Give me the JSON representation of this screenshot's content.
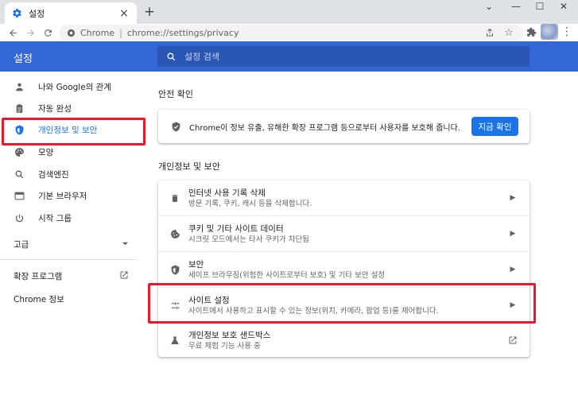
{
  "browser": {
    "tab_title": "설정",
    "tab_close": "×",
    "new_tab": "+",
    "omnibox_origin": "Chrome",
    "omnibox_separator": "|",
    "omnibox_url": "chrome://settings/privacy",
    "window_controls": {
      "chevron": "⌄",
      "minimize": "—",
      "maximize": "☐",
      "close": "✕"
    },
    "menu_glyph": "⋮"
  },
  "header": {
    "title": "설정",
    "search_placeholder": "설정 검색"
  },
  "sidebar": {
    "items": [
      {
        "label": "나와 Google의 관계",
        "icon": "person-icon",
        "active": false
      },
      {
        "label": "자동 완성",
        "icon": "clipboard-icon",
        "active": false
      },
      {
        "label": "개인정보 및 보안",
        "icon": "shield-icon",
        "active": true
      },
      {
        "label": "모양",
        "icon": "palette-icon",
        "active": false
      },
      {
        "label": "검색엔진",
        "icon": "search-icon",
        "active": false
      },
      {
        "label": "기본 브라우저",
        "icon": "browser-window-icon",
        "active": false
      },
      {
        "label": "시작 그룹",
        "icon": "power-icon",
        "active": false
      }
    ],
    "advanced_label": "고급",
    "extensions_label": "확장 프로그램",
    "about_label": "Chrome 정보"
  },
  "safety_check": {
    "section_title": "안전 확인",
    "text": "Chrome이 정보 유출, 유해한 확장 프로그램 등으로부터 사용자를 보호해 줍니다.",
    "button_label": "지금 확인"
  },
  "privacy": {
    "section_title": "개인정보 및 보안",
    "rows": [
      {
        "title": "인터넷 사용 기록 삭제",
        "subtitle": "방문 기록, 쿠키, 캐시 등을 삭제합니다.",
        "icon": "trash-icon",
        "action": "arrow"
      },
      {
        "title": "쿠키 및 기타 사이트 데이터",
        "subtitle": "시크릿 모드에서는 타사 쿠키가 차단됨",
        "icon": "cookie-icon",
        "action": "arrow"
      },
      {
        "title": "보안",
        "subtitle": "세이프 브라우징(위험한 사이트로부터 보호) 및 기타 보안 설정",
        "icon": "shield-icon",
        "action": "arrow"
      },
      {
        "title": "사이트 설정",
        "subtitle": "사이트에서 사용하고 표시할 수 있는 정보(위치, 카메라, 팝업 등)를 제어합니다.",
        "icon": "sliders-icon",
        "action": "arrow"
      },
      {
        "title": "개인정보 보호 샌드박스",
        "subtitle": "무료 체험 기능 사용 중",
        "icon": "flask-icon",
        "action": "external"
      }
    ]
  },
  "colors": {
    "header_blue": "#3367d6",
    "accent_blue": "#1a73e8",
    "highlight_red": "#e8192c"
  }
}
